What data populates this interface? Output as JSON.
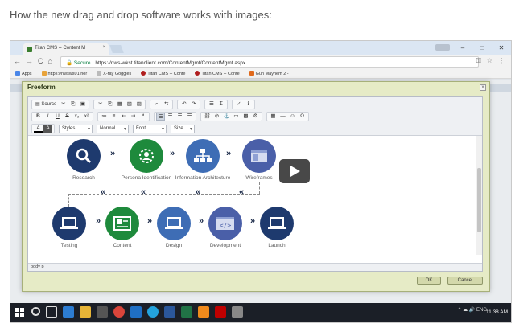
{
  "page_heading": "How the new drag and drop software works with images:",
  "browser": {
    "tab_title": "Titan CMS -- Content M",
    "tab_close": "×",
    "secure_label": "Secure",
    "url": "https://nws-wkst.titanclient.com/ContentMgmt/ContentMgmt.aspx",
    "window_min": "–",
    "window_max": "□",
    "window_close": "✕",
    "nav_back": "←",
    "nav_forward": "→",
    "nav_reload": "C",
    "nav_home": "⌂",
    "bookmarks": [
      {
        "label": "Apps",
        "color": "#4a86e8"
      },
      {
        "label": "https://nwsws01.nor",
        "color": "#e8a33a"
      },
      {
        "label": "X-ray Goggles",
        "color": "#888888"
      },
      {
        "label": "Titan CMS -- Conte",
        "color": "#b01e1e"
      },
      {
        "label": "Titan CMS -- Conte",
        "color": "#b01e1e"
      },
      {
        "label": "Gun Mayhem 2 -",
        "color": "#e0691b"
      }
    ]
  },
  "dialog": {
    "title": "Freeform",
    "close": "x",
    "ok_label": "OK",
    "cancel_label": "Cancel",
    "toolbar": {
      "source_label": "Source",
      "styles_label": "Styles",
      "format_label": "Normal",
      "font_label": "Font",
      "size_label": "Size",
      "bold": "B",
      "italic": "I",
      "underline": "U",
      "strike": "S",
      "subscript": "x₂",
      "superscript": "x²",
      "text_color": "A",
      "bg_color": "A"
    },
    "path_label": "body  p"
  },
  "workflow": {
    "top_row": [
      {
        "label": "Research",
        "color": "#1e3a6e",
        "icon": "magnifier-icon"
      },
      {
        "label": "Persona Identification",
        "color": "#1e8a3c",
        "icon": "persona-icon"
      },
      {
        "label": "Information Architecture",
        "color": "#3e6db5",
        "icon": "sitemap-icon"
      },
      {
        "label": "Wireframes",
        "color": "#4a5fa8",
        "icon": "wireframe-icon"
      }
    ],
    "bottom_row": [
      {
        "label": "Testing",
        "color": "#1e3a6e",
        "icon": "laptop-icon"
      },
      {
        "label": "Content",
        "color": "#1e8a3c",
        "icon": "card-icon"
      },
      {
        "label": "Design",
        "color": "#3e6db5",
        "icon": "laptop-icon"
      },
      {
        "label": "Development",
        "color": "#4a5fa8",
        "icon": "code-icon"
      },
      {
        "label": "Launch",
        "color": "#1e3a6e",
        "icon": "laptop-icon"
      }
    ],
    "arrow_right": "»",
    "arrow_left": "«"
  },
  "taskbar": {
    "clock": "11:38 AM",
    "tray_lang": "ENG"
  }
}
